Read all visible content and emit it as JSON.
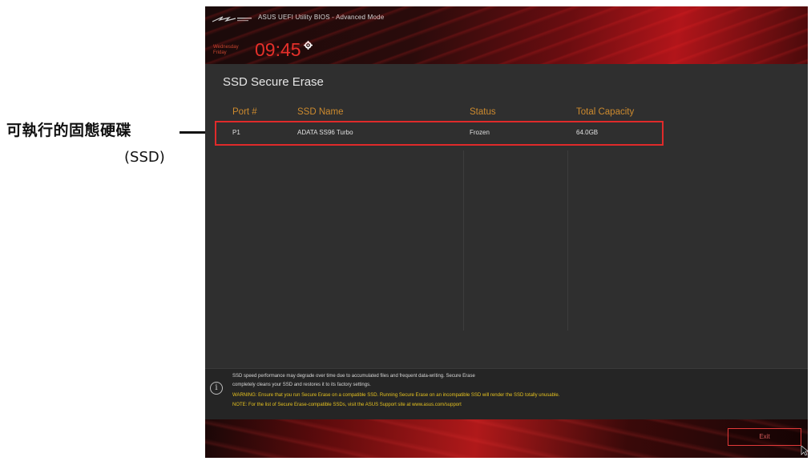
{
  "annotation": {
    "label_line1": "可執行的固態硬碟",
    "label_line2": "(SSD)"
  },
  "header": {
    "app_title": "ASUS UEFI Utility BIOS - Advanced Mode",
    "date_line1": "Wednesday",
    "date_line2": "Friday",
    "clock": "09:45",
    "icons": [
      "rog-logo-icon",
      "gear-icon"
    ]
  },
  "page": {
    "title": "SSD Secure Erase"
  },
  "table": {
    "columns": [
      "Port #",
      "SSD Name",
      "Status",
      "Total Capacity"
    ],
    "rows": [
      [
        "P1",
        "ADATA SS96 Turbo",
        "Frozen",
        "64.0GB"
      ]
    ]
  },
  "info": {
    "icon": "info-icon",
    "line1": "SSD speed performance may degrade over time due to accumulated files and frequent data-writing. Secure Erase",
    "line2": "completely cleans your SSD and restores it to its factory settings.",
    "line3": "WARNING: Ensure that you run Secure Erase on a compatible SSD. Running Secure Erase on an incompatible SSD will render the SSD totally unusable.",
    "line4": "NOTE: For the list of Secure Erase-compatible SSDs, visit the ASUS Support site at www.asus.com/support"
  },
  "footer": {
    "exit_label": "Exit"
  },
  "colors": {
    "accent_red": "#e02a2a",
    "header_orange": "#cc8a2e",
    "warning_yellow": "#e6c21f",
    "panel_gray": "#2f2f2f"
  }
}
